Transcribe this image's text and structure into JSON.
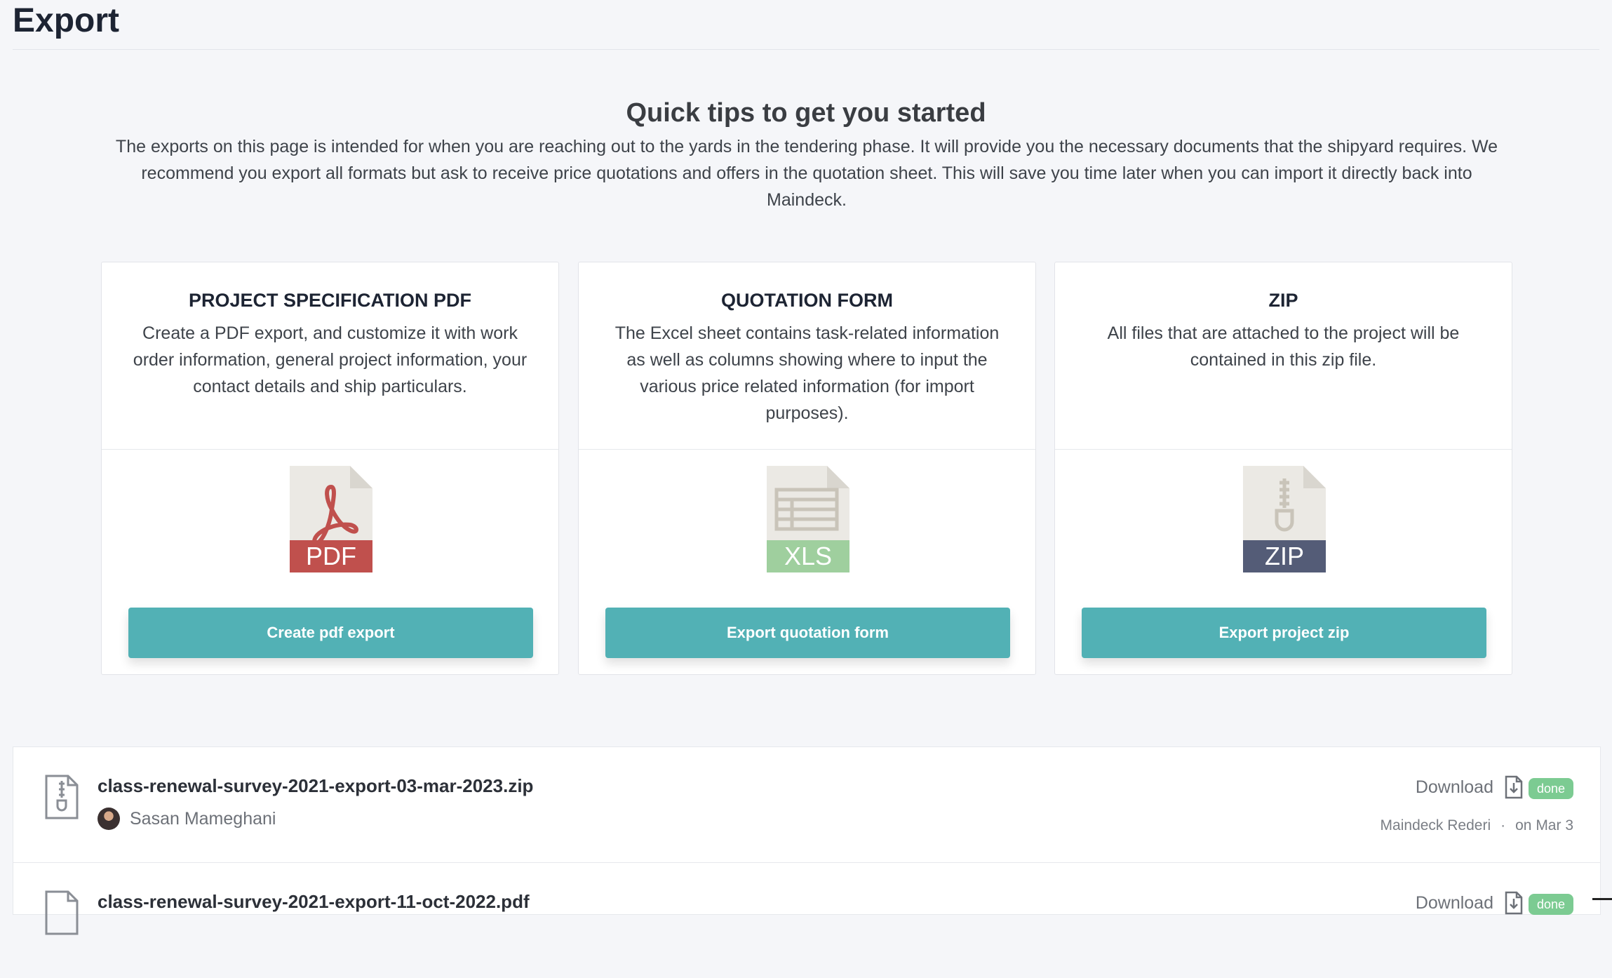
{
  "page": {
    "title": "Export"
  },
  "tips": {
    "heading": "Quick tips to get you started",
    "text": "The exports on this page is intended for when you are reaching out to the yards in the tendering phase. It will provide you the necessary documents that the shipyard requires. We recommend you export all formats but ask to receive price quotations and offers in the quotation sheet. This will save you time later when you can import it directly back into Maindeck."
  },
  "cards": [
    {
      "title": "PROJECT SPECIFICATION PDF",
      "description": "Create a PDF export, and customize it with work order information, general project information, your contact details and ship particulars.",
      "icon": "pdf-file-icon",
      "icon_label": "PDF",
      "icon_color": "#c0504d",
      "button": "Create pdf export"
    },
    {
      "title": "QUOTATION FORM",
      "description": "The Excel sheet contains task-related information as well as columns showing where to input the various price related information (for import purposes).",
      "icon": "xls-file-icon",
      "icon_label": "XLS",
      "icon_color": "#9fcf9e",
      "button": "Export quotation form"
    },
    {
      "title": "ZIP",
      "description": "All files that are attached to the project will be contained in this zip file.",
      "icon": "zip-file-icon",
      "icon_label": "ZIP",
      "icon_color": "#545c77",
      "button": "Export project zip"
    }
  ],
  "exports": [
    {
      "filename": "class-renewal-survey-2021-export-03-mar-2023.zip",
      "user": "Sasan Mameghani",
      "download_label": "Download",
      "status": "done",
      "company": "Maindeck Rederi",
      "separator": "·",
      "date": "on Mar 3"
    },
    {
      "filename": "class-renewal-survey-2021-export-11-oct-2022.pdf",
      "download_label": "Download",
      "status": "done"
    }
  ],
  "colors": {
    "accent": "#52b1b5",
    "badge_done": "#7ccb92",
    "background": "#f5f6f9"
  }
}
